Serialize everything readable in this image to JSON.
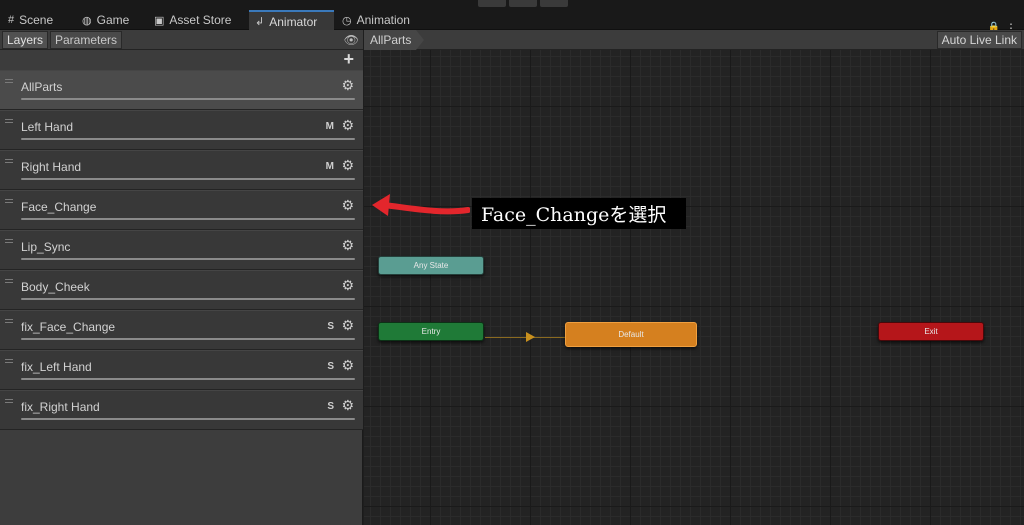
{
  "tabs": [
    {
      "label": "Scene",
      "icon": "grid-icon"
    },
    {
      "label": "Game",
      "icon": "gamepad-icon"
    },
    {
      "label": "Asset Store",
      "icon": "bag-icon"
    },
    {
      "label": "Animator",
      "icon": "animator-icon"
    },
    {
      "label": "Animation",
      "icon": "clock-icon"
    }
  ],
  "left_panel": {
    "subtabs": [
      "Layers",
      "Parameters"
    ],
    "layers": [
      {
        "name": "AllParts",
        "mask": ""
      },
      {
        "name": "Left Hand",
        "mask": "M"
      },
      {
        "name": "Right Hand",
        "mask": "M"
      },
      {
        "name": "Face_Change",
        "mask": ""
      },
      {
        "name": "Lip_Sync",
        "mask": ""
      },
      {
        "name": "Body_Cheek",
        "mask": ""
      },
      {
        "name": "fix_Face_Change",
        "mask": "S"
      },
      {
        "name": "fix_Left Hand",
        "mask": "S"
      },
      {
        "name": "fix_Right Hand",
        "mask": "S"
      }
    ],
    "selected_layer": "AllParts"
  },
  "graph": {
    "breadcrumb": "AllParts",
    "auto_live_link": "Auto Live Link",
    "nodes": {
      "any_state": "Any State",
      "entry": "Entry",
      "default": "Default",
      "exit": "Exit"
    }
  },
  "annotation": {
    "text": "Face_Changeを選択"
  },
  "colors": {
    "any_state": "#5a9d92",
    "entry": "#1f7a37",
    "default": "#d5801f",
    "exit": "#b5161a",
    "annotation_arrow": "#e3262c",
    "active_tab_accent": "#3a79bb"
  }
}
